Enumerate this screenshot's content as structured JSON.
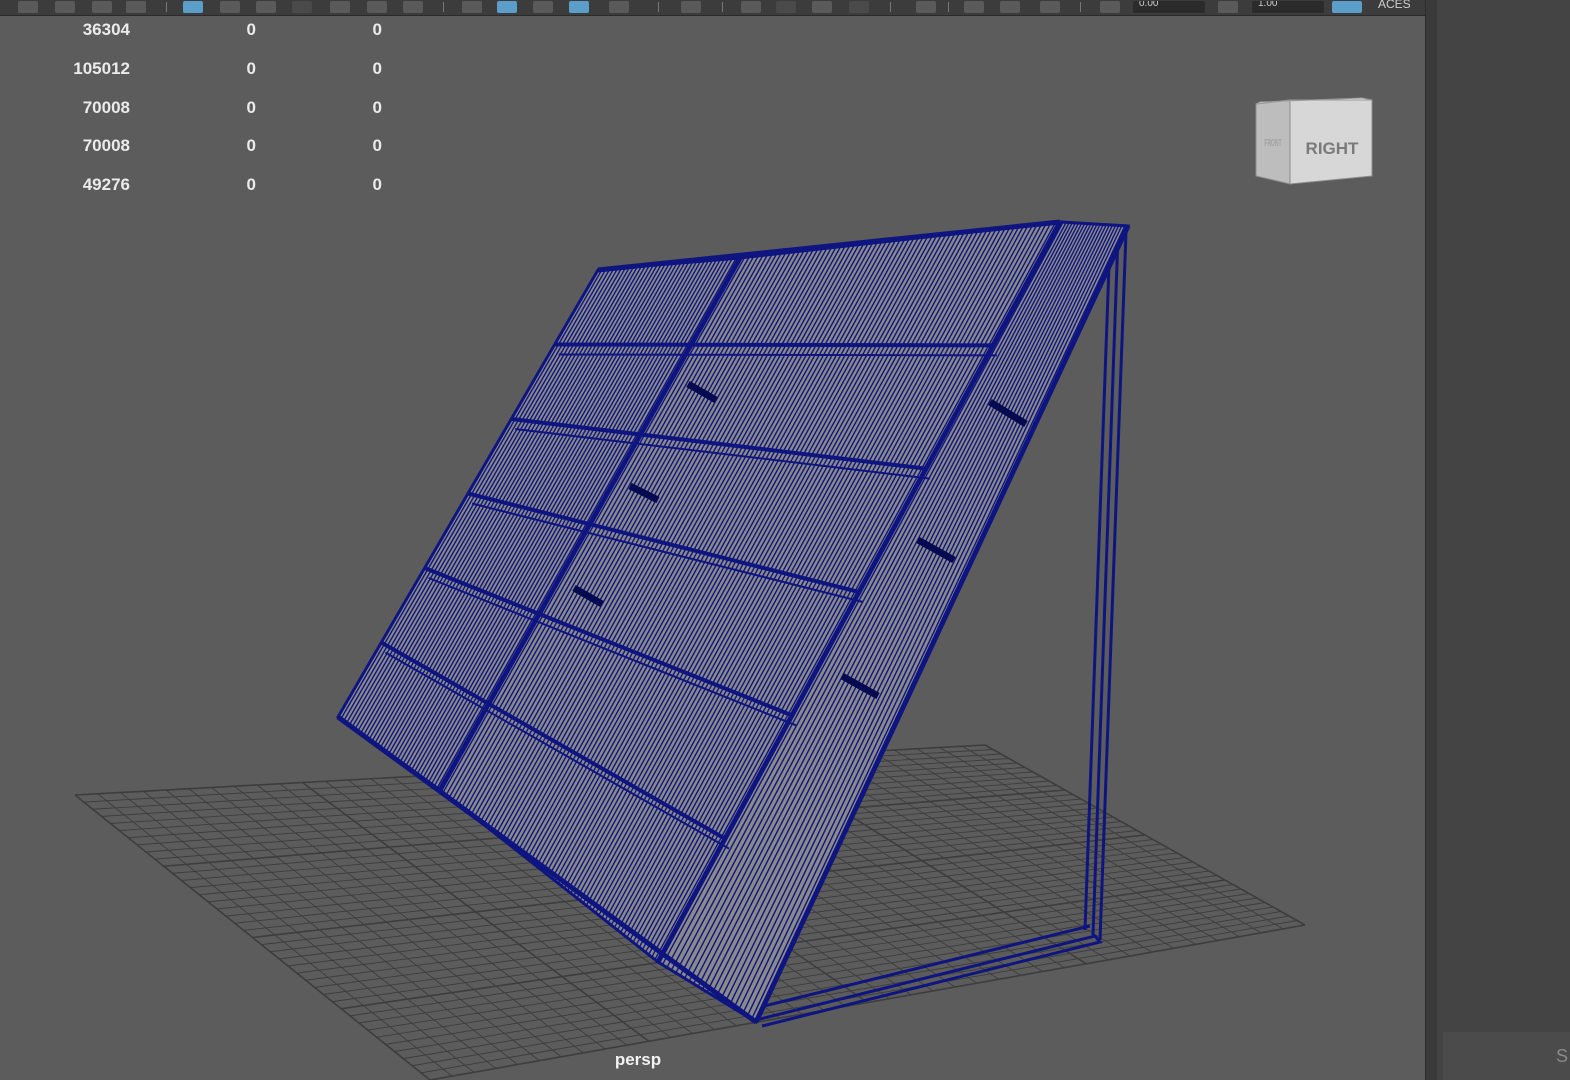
{
  "toolbar": {
    "field_a": "0.00",
    "field_b": "1.00",
    "colorspace_label": "ACES"
  },
  "hud": {
    "rows": [
      [
        "36304",
        "0",
        "0"
      ],
      [
        "105012",
        "0",
        "0"
      ],
      [
        "70008",
        "0",
        "0"
      ],
      [
        "70008",
        "0",
        "0"
      ],
      [
        "49276",
        "0",
        "0"
      ]
    ]
  },
  "viewport": {
    "camera_label": "persp",
    "viewcube": {
      "face_right": "RIGHT",
      "face_front": "FRONT"
    },
    "colors": {
      "background": "#5c5c5c",
      "grid": "#3d3d3d",
      "wireframe": "#0f1580",
      "surface": "#8a8a8a"
    }
  },
  "right_panel": {
    "partial_label": "S"
  }
}
